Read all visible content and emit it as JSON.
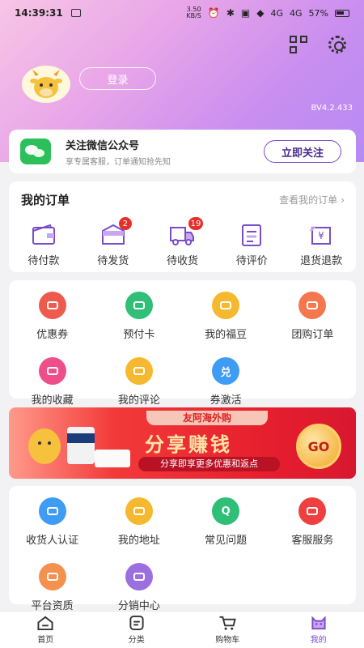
{
  "status_bar": {
    "time": "14:39:31",
    "net_speed": "3.50",
    "net_unit": "KB/S",
    "signal_1": "4G",
    "signal_2": "4G",
    "battery": "57%"
  },
  "profile": {
    "login_label": "登录",
    "version": "BV4.2.433"
  },
  "wechat": {
    "title": "关注微信公众号",
    "subtitle": "享专属客服，订单通知抢先知",
    "follow_label": "立即关注"
  },
  "orders": {
    "title": "我的订单",
    "view_all": "查看我的订单",
    "items": [
      {
        "label": "待付款",
        "icon": "wallet-icon"
      },
      {
        "label": "待发货",
        "icon": "package-icon",
        "badge": "2"
      },
      {
        "label": "待收货",
        "icon": "truck-icon",
        "badge": "19"
      },
      {
        "label": "待评价",
        "icon": "clipboard-icon"
      },
      {
        "label": "退货退款",
        "icon": "refund-icon"
      }
    ]
  },
  "services_1": [
    {
      "label": "优惠券",
      "icon": "coupon-icon",
      "color": "#ef5a4f"
    },
    {
      "label": "预付卡",
      "icon": "card-icon",
      "color": "#2fbf76"
    },
    {
      "label": "我的福豆",
      "icon": "beans-icon",
      "color": "#f5b82e"
    },
    {
      "label": "团购订单",
      "icon": "group-icon",
      "color": "#f4774f"
    },
    {
      "label": "我的收藏",
      "icon": "star-icon",
      "color": "#ee4f8a"
    },
    {
      "label": "我的评论",
      "icon": "comment-icon",
      "color": "#f5b82e"
    },
    {
      "label": "券激活",
      "icon": "activate-icon",
      "color": "#3f9cf5",
      "glyph": "兑"
    }
  ],
  "banner": {
    "top_label": "友阿海外购",
    "title": "分享赚钱",
    "subtitle": "分享即享更多优惠和返点",
    "go_label": "GO"
  },
  "services_2": [
    {
      "label": "收货人认证",
      "icon": "id-card-icon",
      "color": "#3f9cf5"
    },
    {
      "label": "我的地址",
      "icon": "location-icon",
      "color": "#f5b82e"
    },
    {
      "label": "常见问题",
      "icon": "question-icon",
      "color": "#2fbf76",
      "glyph": "Q"
    },
    {
      "label": "客服服务",
      "icon": "headset-icon",
      "color": "#ef4040"
    },
    {
      "label": "平台资质",
      "icon": "certificate-icon",
      "color": "#f4914f"
    },
    {
      "label": "分销中心",
      "icon": "distribution-icon",
      "color": "#9b6fe0"
    }
  ],
  "tabbar": [
    {
      "label": "首页",
      "icon": "home-icon"
    },
    {
      "label": "分类",
      "icon": "category-icon"
    },
    {
      "label": "购物车",
      "icon": "cart-icon"
    },
    {
      "label": "我的",
      "icon": "profile-icon",
      "active": true
    }
  ],
  "colors": {
    "accent": "#7a4cc8",
    "badge": "#e5302a"
  }
}
